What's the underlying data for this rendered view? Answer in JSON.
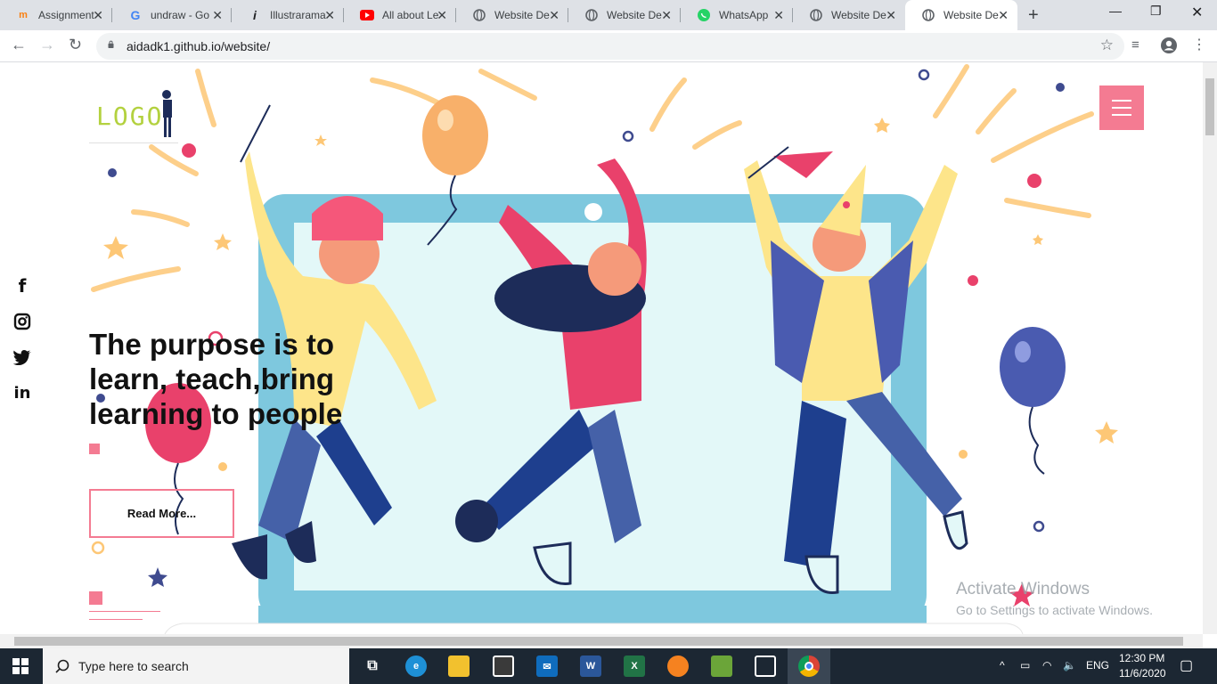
{
  "browser": {
    "tabs": [
      {
        "title": "Assignment",
        "favicon": "moodle-icon",
        "favicon_color": "#f98012"
      },
      {
        "title": "undraw - Go",
        "favicon": "google-icon",
        "favicon_color": "#4285f4"
      },
      {
        "title": "Illustrarama",
        "favicon": "info-icon",
        "favicon_color": "#202124"
      },
      {
        "title": "All about Le",
        "favicon": "youtube-icon",
        "favicon_color": "#ff0000"
      },
      {
        "title": "Website De",
        "favicon": "globe-icon",
        "favicon_color": "#5f6368"
      },
      {
        "title": "Website De",
        "favicon": "globe-icon",
        "favicon_color": "#5f6368"
      },
      {
        "title": "WhatsApp",
        "favicon": "whatsapp-icon",
        "favicon_color": "#25d366"
      },
      {
        "title": "Website De",
        "favicon": "globe-icon",
        "favicon_color": "#5f6368"
      },
      {
        "title": "Website De",
        "favicon": "globe-icon",
        "favicon_color": "#5f6368",
        "active": true
      }
    ],
    "url": "aidadk1.github.io/website/"
  },
  "page": {
    "logo_text": "LOGO",
    "headline": "The purpose is to learn, teach,bring learning to people",
    "read_more_label": "Read More...",
    "social_icons": [
      "facebook-icon",
      "instagram-icon",
      "twitter-icon",
      "linkedin-icon"
    ],
    "accent_color": "#f47b92"
  },
  "watermark": {
    "line1": "Activate Windows",
    "line2": "Go to Settings to activate Windows."
  },
  "taskbar": {
    "search_placeholder": "Type here to search",
    "language": "ENG",
    "time": "12:30 PM",
    "date": "11/6/2020"
  }
}
